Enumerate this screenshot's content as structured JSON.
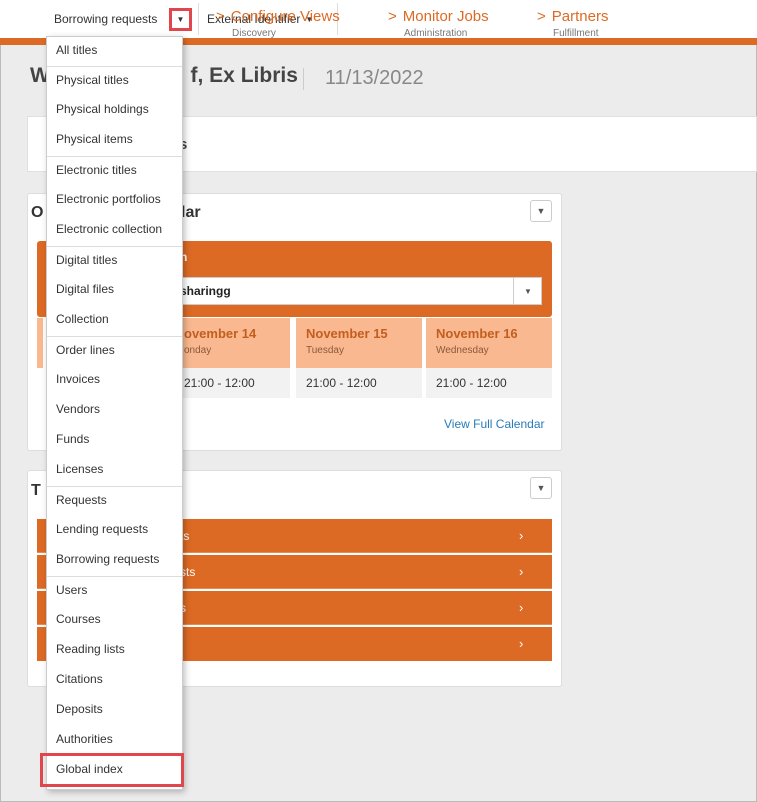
{
  "search_bar": {
    "search_type": "Borrowing requests",
    "external_identifier": "External Identifier"
  },
  "welcome": {
    "name_fragment": "W",
    "name_rest": "f, Ex Libris",
    "date": "11/13/2022"
  },
  "shortcuts": {
    "first_fragment": "s",
    "items": [
      {
        "label": "Configure Views",
        "sub": "Discovery"
      },
      {
        "label": "Monitor Jobs",
        "sub": "Administration"
      },
      {
        "label": "Partners",
        "sub": "Fulfillment"
      }
    ]
  },
  "calendar_widget": {
    "title_left": "O",
    "title_right": "lar",
    "header_fragment": "n",
    "selected_location": "sharingg",
    "days": [
      {
        "name": "November 14",
        "weekday": "Monday",
        "hours": "21:00 - 12:00",
        "name_shown": "ovember 14",
        "weekday_shown": "onday",
        "hours_shown": "21:00 - 12:00"
      },
      {
        "name": "November 15",
        "weekday": "Tuesday",
        "hours": "21:00 - 12:00"
      },
      {
        "name": "November 16",
        "weekday": "Wednesday",
        "hours": "21:00 - 12:00"
      }
    ],
    "view_full": "View Full Calendar"
  },
  "tasks_widget": {
    "title_left": "T",
    "rows": [
      {
        "fragment": "ts"
      },
      {
        "fragment": "sts"
      },
      {
        "fragment": "s"
      },
      {
        "fragment": ""
      }
    ]
  },
  "menu": {
    "items": [
      "All titles",
      "Physical titles",
      "Physical holdings",
      "Physical items",
      "Electronic titles",
      "Electronic portfolios",
      "Electronic collection",
      "Digital titles",
      "Digital files",
      "Collection",
      "Order lines",
      "Invoices",
      "Vendors",
      "Funds",
      "Licenses",
      "Requests",
      "Lending requests",
      "Borrowing requests",
      "Users",
      "Courses",
      "Reading lists",
      "Citations",
      "Deposits",
      "Authorities",
      "Global index"
    ]
  },
  "colors": {
    "brand_orange": "#dc6a24",
    "highlight_red": "#e0464c",
    "day_header": "#f9b88f",
    "link_blue": "#2a7ab8"
  }
}
